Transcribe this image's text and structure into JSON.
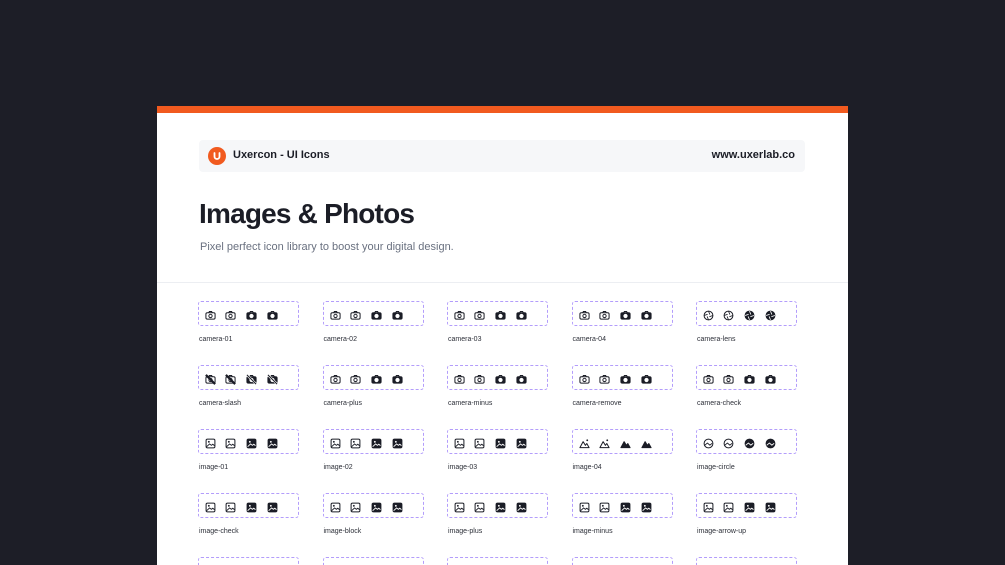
{
  "colors": {
    "background": "#1d1e27",
    "accent": "#f15a1f",
    "icon_box_border": "#b39dfb",
    "icon": "#1b1d26"
  },
  "brand": {
    "logo_icon": "uxercon-logo-icon",
    "name": "Uxercon - UI Icons",
    "url": "www.uxerlab.co"
  },
  "page": {
    "title": "Images & Photos",
    "subtitle": "Pixel perfect icon library to boost your digital design."
  },
  "icons": [
    {
      "label": "camera-01",
      "kind": "camera"
    },
    {
      "label": "camera-02",
      "kind": "camera"
    },
    {
      "label": "camera-03",
      "kind": "camera"
    },
    {
      "label": "camera-04",
      "kind": "camera"
    },
    {
      "label": "camera-lens",
      "kind": "lens"
    },
    {
      "label": "camera-slash",
      "kind": "camera-slash"
    },
    {
      "label": "camera-plus",
      "kind": "camera"
    },
    {
      "label": "camera-minus",
      "kind": "camera"
    },
    {
      "label": "camera-remove",
      "kind": "camera"
    },
    {
      "label": "camera-check",
      "kind": "camera"
    },
    {
      "label": "image-01",
      "kind": "image"
    },
    {
      "label": "image-02",
      "kind": "image"
    },
    {
      "label": "image-03",
      "kind": "image"
    },
    {
      "label": "image-04",
      "kind": "mountain"
    },
    {
      "label": "image-circle",
      "kind": "image-circle"
    },
    {
      "label": "image-check",
      "kind": "image"
    },
    {
      "label": "image-block",
      "kind": "image"
    },
    {
      "label": "image-plus",
      "kind": "image"
    },
    {
      "label": "image-minus",
      "kind": "image"
    },
    {
      "label": "image-arrow-up",
      "kind": "image"
    }
  ]
}
